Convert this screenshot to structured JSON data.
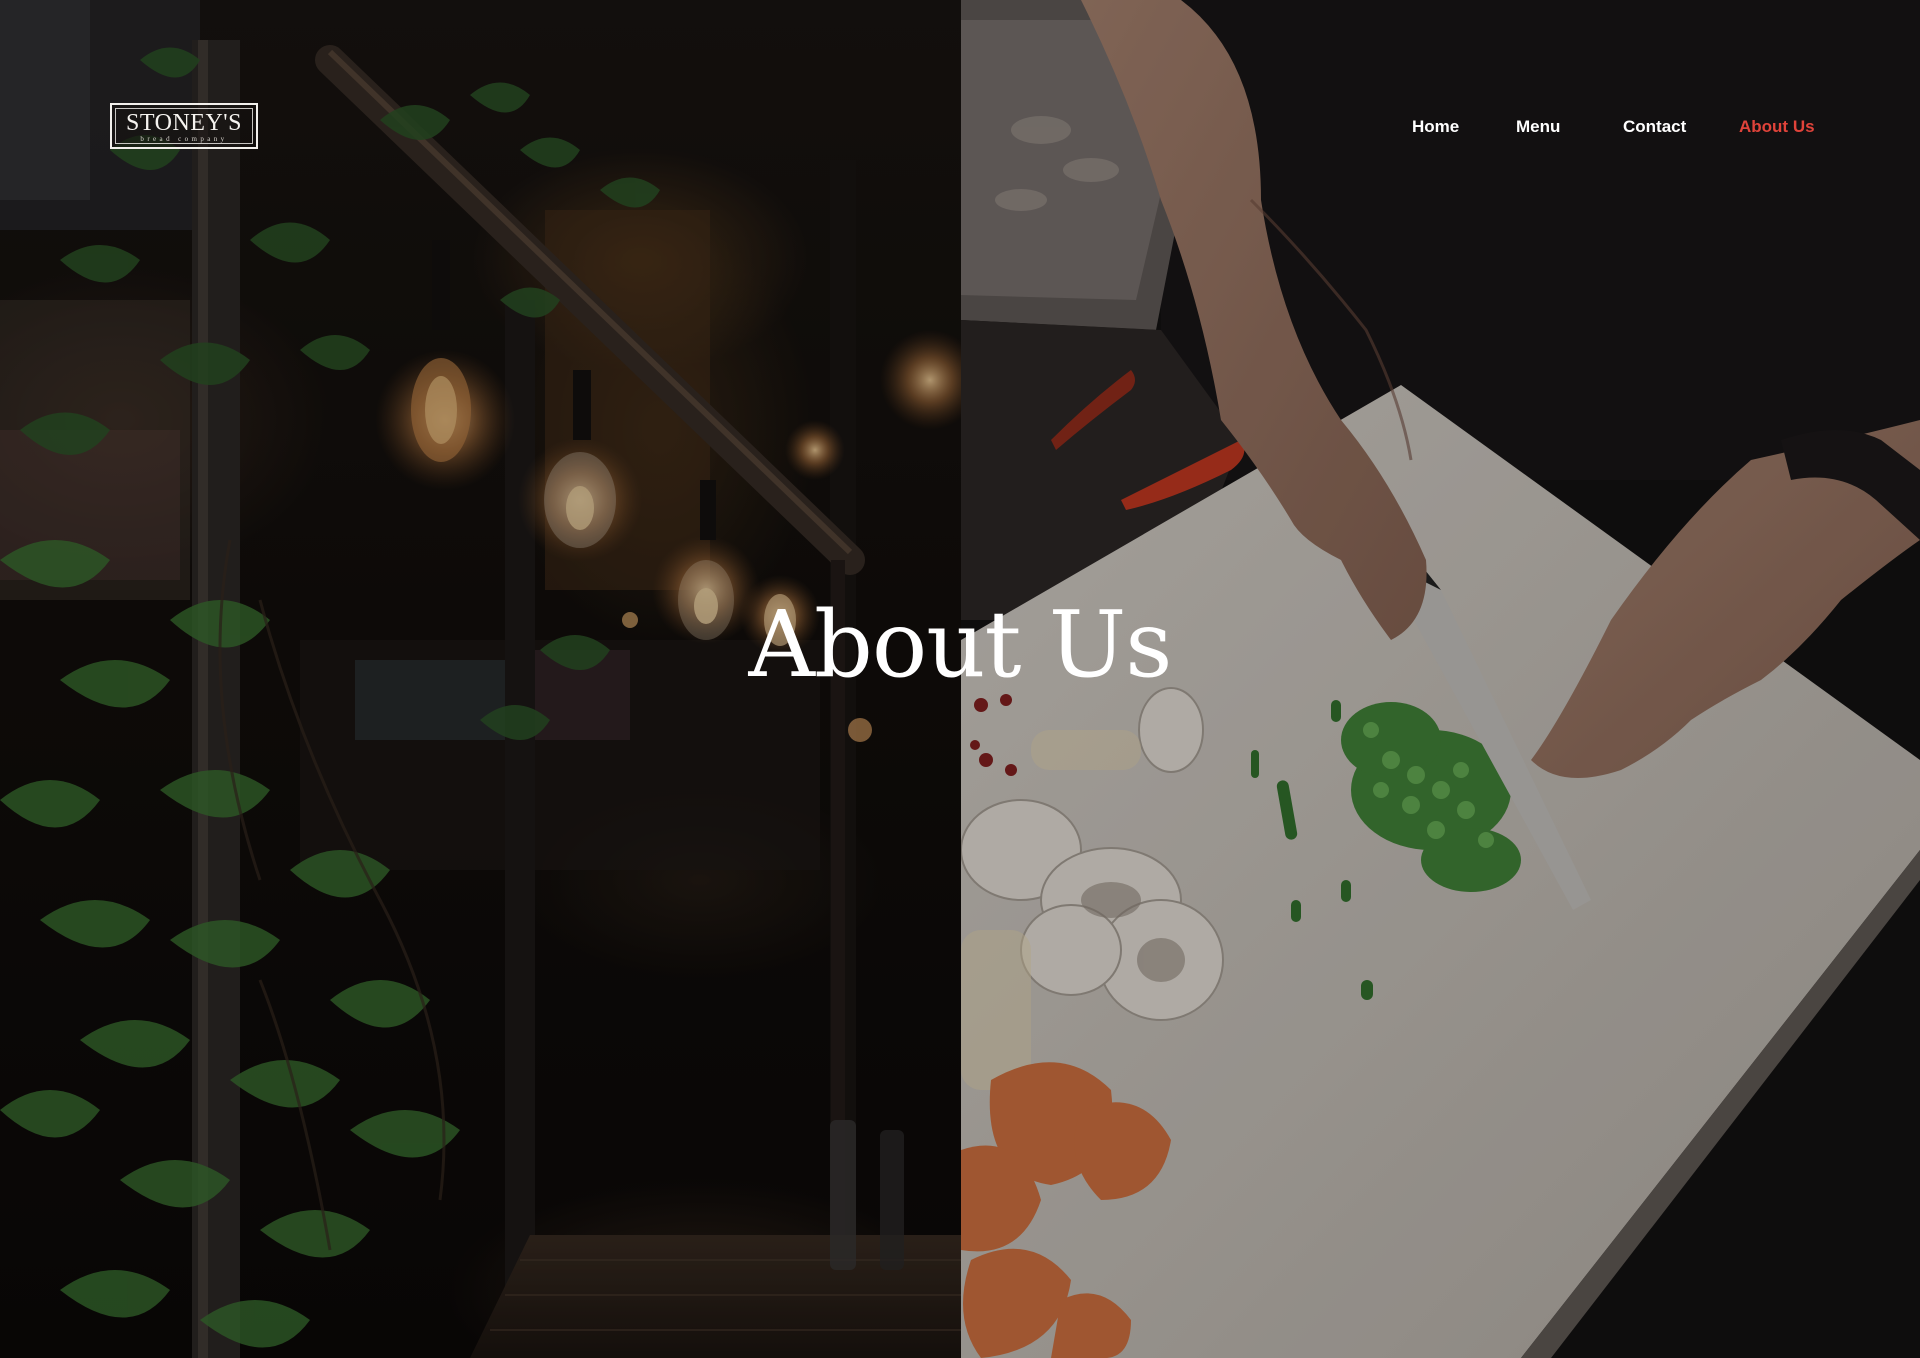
{
  "brand": {
    "name": "STONEY'S",
    "tagline": "bread company"
  },
  "nav": {
    "items": [
      {
        "label": "Home"
      },
      {
        "label": "Menu"
      },
      {
        "label": "Contact"
      },
      {
        "label": "About Us"
      }
    ],
    "active_index": 3,
    "active_color": "#e0433a",
    "link_color": "#ffffff"
  },
  "hero": {
    "title": "About Us",
    "images": [
      {
        "icon": "restaurant-interior-photo"
      },
      {
        "icon": "chef-chopping-vegetables-photo"
      }
    ]
  }
}
